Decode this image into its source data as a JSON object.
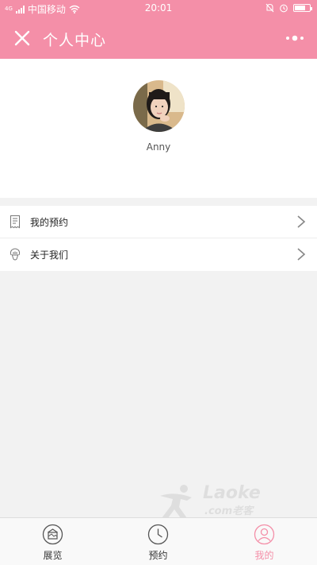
{
  "status_bar": {
    "network_badge": "4G",
    "carrier": "中国移动",
    "time": "20:01",
    "battery_level": 0.7
  },
  "title_bar": {
    "title": "个人中心",
    "close_icon": "close-icon",
    "more_icon": "more-dots-icon"
  },
  "profile": {
    "username": "Anny",
    "avatar_icon": "avatar-photo"
  },
  "menu": {
    "items": [
      {
        "label": "我的预约",
        "icon": "receipt-icon"
      },
      {
        "label": "关于我们",
        "icon": "info-hand-icon"
      }
    ]
  },
  "watermark": {
    "line1": "Laoke",
    "line2": ".com老客"
  },
  "tab_bar": {
    "tabs": [
      {
        "label": "展览",
        "icon": "exhibition-icon",
        "active": false
      },
      {
        "label": "预约",
        "icon": "clock-icon",
        "active": false
      },
      {
        "label": "我的",
        "icon": "user-icon",
        "active": true
      }
    ]
  },
  "colors": {
    "accent": "#f48fa8",
    "background": "#f2f2f2",
    "card": "#ffffff"
  }
}
